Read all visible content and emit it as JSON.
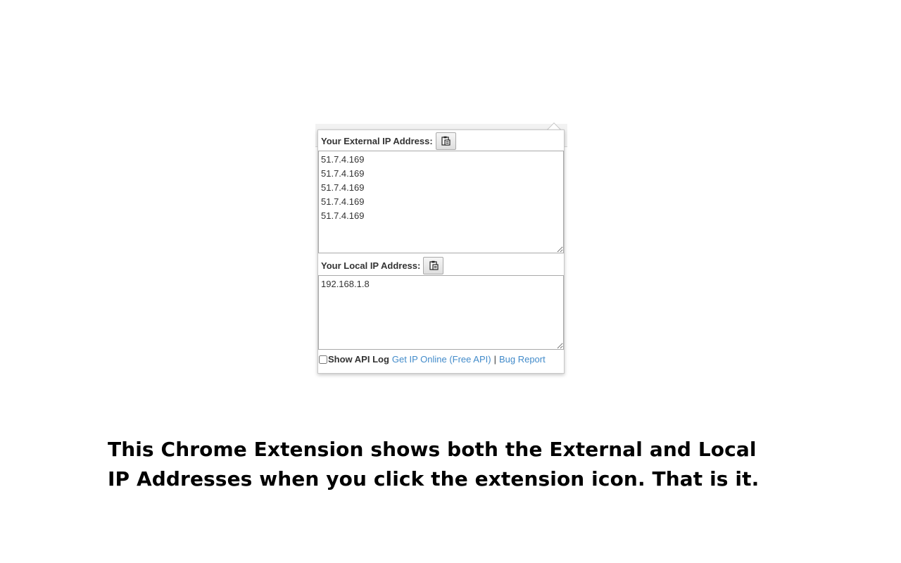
{
  "popup": {
    "external": {
      "label": "Your External IP Address:",
      "value": "51.7.4.169\n51.7.4.169\n51.7.4.169\n51.7.4.169\n51.7.4.169",
      "copy_icon": "clipboard-icon"
    },
    "local": {
      "label": "Your Local IP Address:",
      "value": "192.168.1.8",
      "copy_icon": "clipboard-icon"
    },
    "footer": {
      "show_log_label": "Show API Log",
      "show_log_checked": false,
      "get_ip_link": "Get IP Online (Free API)",
      "separator": "|",
      "bug_report_link": "Bug Report"
    },
    "link_color": "#428bca"
  },
  "caption": "This Chrome Extension shows both the External and Local IP Addresses when you click the extension icon. That is it."
}
